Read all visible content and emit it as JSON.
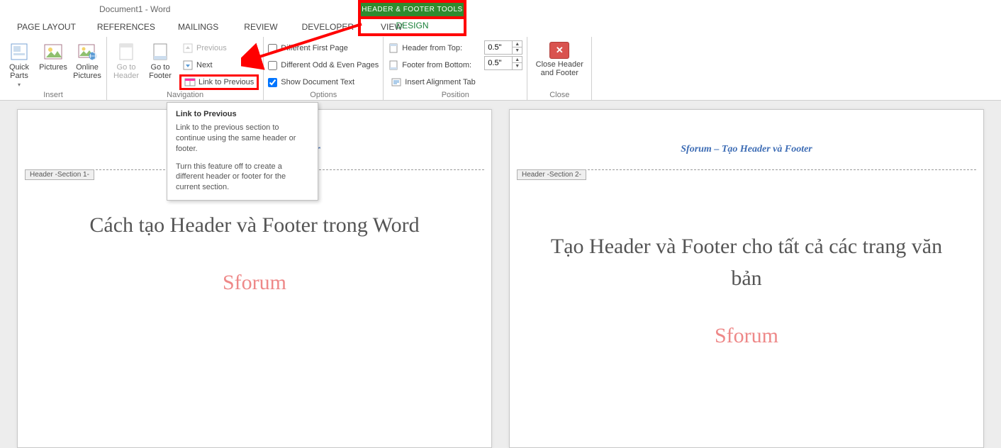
{
  "title": "Document1 - Word",
  "context_tab": "HEADER & FOOTER TOOLS",
  "tabs": {
    "page_layout": "PAGE LAYOUT",
    "references": "REFERENCES",
    "mailings": "MAILINGS",
    "review": "REVIEW",
    "developer": "DEVELOPER",
    "view": "VIEW",
    "design": "DESIGN"
  },
  "ribbon": {
    "insert": {
      "label": "Insert",
      "quick_parts": "Quick Parts",
      "pictures": "Pictures",
      "online_pictures": "Online Pictures"
    },
    "navigation": {
      "label": "Navigation",
      "goto_header": "Go to Header",
      "goto_footer": "Go to Footer",
      "previous": "Previous",
      "next": "Next",
      "link_to_previous": "Link to Previous"
    },
    "options": {
      "label": "Options",
      "different_first": "Different First Page",
      "different_odd_even": "Different Odd & Even Pages",
      "show_doc_text": "Show Document Text"
    },
    "position": {
      "label": "Position",
      "header_from_top": "Header from Top:",
      "footer_from_bottom": "Footer from Bottom:",
      "insert_align_tab": "Insert Alignment Tab",
      "header_value": "0.5\"",
      "footer_value": "0.5\""
    },
    "close": {
      "label": "Close",
      "close_header_footer": "Close Header and Footer"
    }
  },
  "tooltip": {
    "title": "Link to Previous",
    "p1": "Link to the previous section to continue using the same header or footer.",
    "p2": "Turn this feature off to create a different header or footer for the current section."
  },
  "pages": {
    "p1": {
      "header": "Sforum – Tạo Header và Footer",
      "tag": "Header -Section 1-",
      "title": "Cách tạo Header và Footer trong Word",
      "brand": "Sforum"
    },
    "p2": {
      "header": "Sforum – Tạo Header và Footer",
      "tag": "Header -Section 2-",
      "title": "Tạo Header và Footer cho tất cả các trang văn bản",
      "brand": "Sforum"
    }
  }
}
